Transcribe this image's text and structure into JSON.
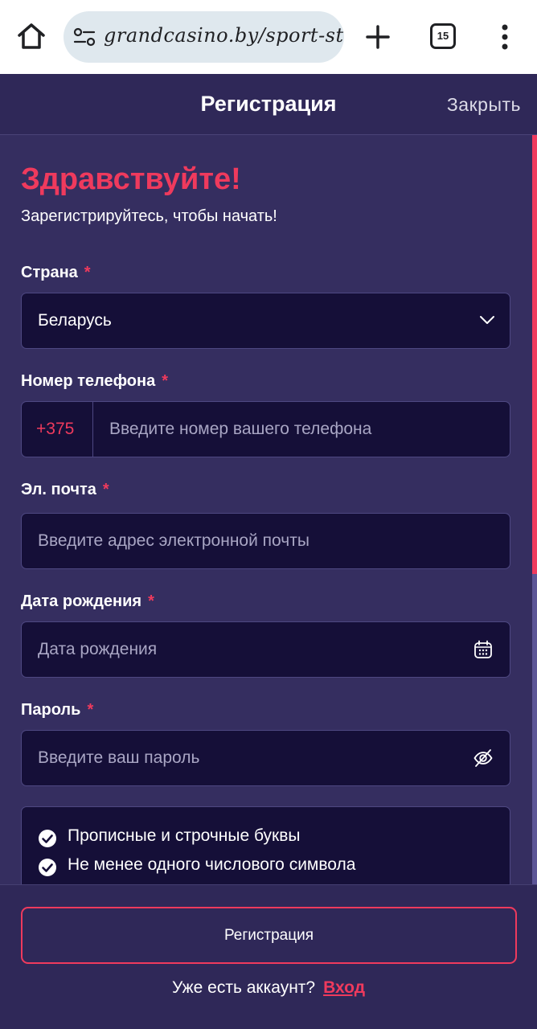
{
  "browser": {
    "url": "grandcasino.by/sport-st",
    "tab_count": "15",
    "icons": [
      "home-icon",
      "site-settings-icon",
      "new-tab-icon",
      "tab-switcher-icon",
      "menu-icon"
    ]
  },
  "header": {
    "title": "Регистрация",
    "close_label": "Закрыть"
  },
  "form": {
    "greeting": "Здравствуйте!",
    "subtitle": "Зарегистрируйтесь, чтобы начать!",
    "required_mark": "*",
    "country": {
      "label": "Страна",
      "value": "Беларусь"
    },
    "phone": {
      "label": "Номер телефона",
      "prefix": "+375",
      "placeholder": "Введите номер вашего телефона"
    },
    "email": {
      "label": "Эл. почта",
      "placeholder": "Введите адрес электронной почты"
    },
    "birthdate": {
      "label": "Дата рождения",
      "placeholder": "Дата рождения"
    },
    "password": {
      "label": "Пароль",
      "placeholder": "Введите ваш пароль"
    },
    "password_rules": [
      "Прописные и строчные буквы",
      "Не менее одного числового символа"
    ]
  },
  "footer": {
    "register_label": "Регистрация",
    "have_account": "Уже есть аккаунт?",
    "login_label": "Вход"
  },
  "colors": {
    "accent": "#ef3a5d",
    "background": "#352e60",
    "field_background": "#150f38"
  }
}
